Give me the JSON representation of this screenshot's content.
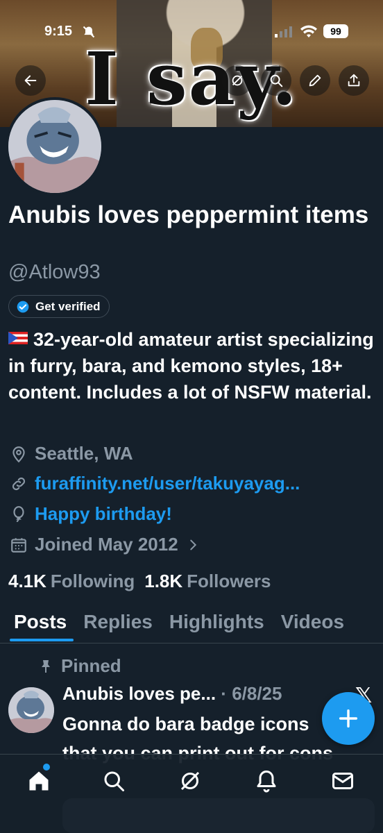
{
  "status_bar": {
    "time": "9:15",
    "battery": "99"
  },
  "banner": {
    "text": "I say."
  },
  "profile": {
    "name": "Anubis loves peppermint items",
    "handle": "@Atlow93",
    "verify_label": "Get verified",
    "bio": "32-year-old amateur artist specializing in furry, bara, and kemono styles, 18+ content. Includes a lot of NSFW material.",
    "location": "Seattle, WA",
    "website": "furaffinity.net/user/takuyayag...",
    "birthday": "Happy birthday!",
    "joined": "Joined May 2012",
    "following_count": "4.1K",
    "following_label": "Following",
    "followers_count": "1.8K",
    "followers_label": "Followers"
  },
  "tabs": [
    "Posts",
    "Replies",
    "Highlights",
    "Videos"
  ],
  "post": {
    "pinned_label": "Pinned",
    "author": "Anubis loves pe...",
    "date": "6/8/25",
    "line1": "Gonna do bara badge icons",
    "line2": "that you can print out for cons"
  },
  "colors": {
    "accent": "#1d9bf0",
    "background": "#15202b",
    "muted": "#8b98a5"
  }
}
